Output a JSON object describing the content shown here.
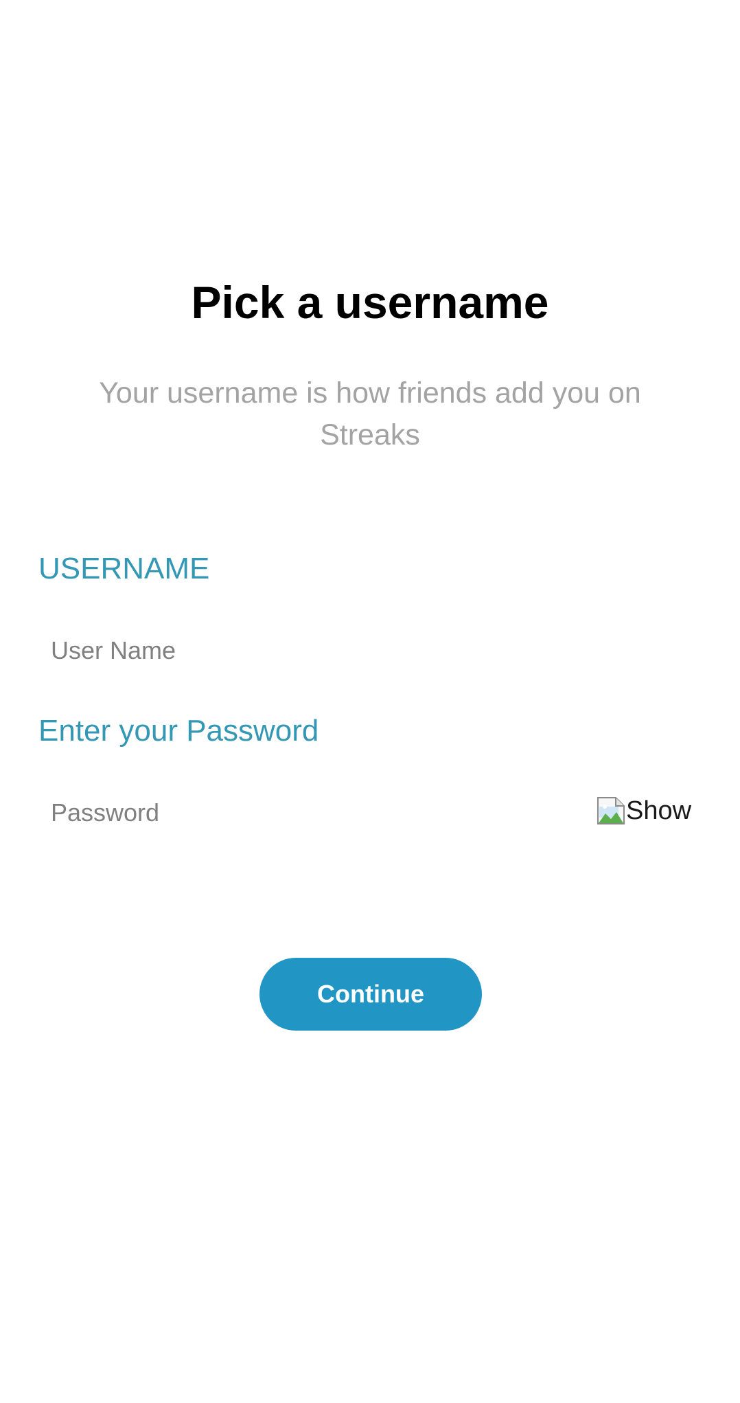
{
  "page": {
    "title": "Pick a username",
    "subtitle": "Your username is how friends add you on Streaks"
  },
  "username_field": {
    "label": "USERNAME",
    "placeholder": "User Name",
    "value": ""
  },
  "password_field": {
    "label": "Enter your Password",
    "placeholder": "Password",
    "value": "",
    "toggle_label": "Show",
    "toggle_icon": "broken-image-icon"
  },
  "actions": {
    "continue_label": "Continue"
  },
  "colors": {
    "accent": "#2196c5",
    "label": "#3497b4",
    "subtitle": "#a3a3a3",
    "placeholder": "#808080",
    "title": "#000000",
    "background": "#ffffff"
  }
}
